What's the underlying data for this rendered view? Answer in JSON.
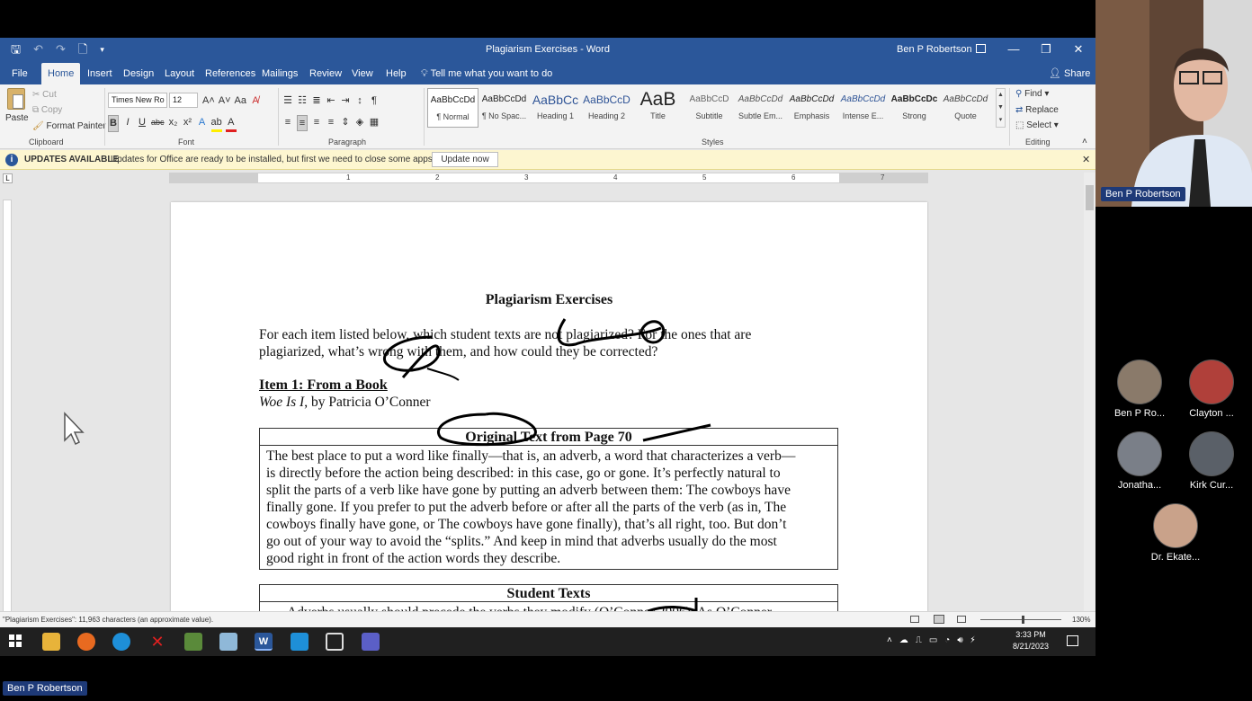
{
  "window": {
    "title": "Plagiarism Exercises  -  Word",
    "user": "Ben P Robertson",
    "minimize": "—",
    "maximize": "❐",
    "close": "✕"
  },
  "quick_access": {
    "save": "🖫",
    "undo": "↶",
    "redo": "↷",
    "new": "🗋",
    "more": "▾"
  },
  "tabs": [
    "File",
    "Home",
    "Insert",
    "Design",
    "Layout",
    "References",
    "Mailings",
    "Review",
    "View",
    "Help"
  ],
  "active_tab": "Home",
  "tell_me": "Tell me what you want to do",
  "share": "Share",
  "clipboard": {
    "paste": "Paste",
    "cut": "Cut",
    "copy": "Copy",
    "format_painter": "Format Painter",
    "label": "Clipboard"
  },
  "font": {
    "name": "Times New Ro",
    "size": "12",
    "label": "Font",
    "bold": "B",
    "italic": "I",
    "underline": "U",
    "strike": "abc",
    "sub": "x₂",
    "sup": "x²",
    "grow": "A˄",
    "shrink": "A˅",
    "case": "Aa",
    "text_effects": "A",
    "highlight": "ab",
    "color": "A"
  },
  "paragraph": {
    "label": "Paragraph"
  },
  "styles": {
    "label": "Styles",
    "items": [
      {
        "preview": "AaBbCcDd",
        "name": "¶ Normal"
      },
      {
        "preview": "AaBbCcDd",
        "name": "¶ No Spac..."
      },
      {
        "preview": "AaBbCc",
        "name": "Heading 1"
      },
      {
        "preview": "AaBbCcD",
        "name": "Heading 2"
      },
      {
        "preview": "AaB",
        "name": "Title"
      },
      {
        "preview": "AaBbCcD",
        "name": "Subtitle"
      },
      {
        "preview": "AaBbCcDd",
        "name": "Subtle Em..."
      },
      {
        "preview": "AaBbCcDd",
        "name": "Emphasis"
      },
      {
        "preview": "AaBbCcDd",
        "name": "Intense E..."
      },
      {
        "preview": "AaBbCcDc",
        "name": "Strong"
      },
      {
        "preview": "AaBbCcDd",
        "name": "Quote"
      }
    ]
  },
  "editing": {
    "find": "Find",
    "replace": "Replace",
    "select": "Select",
    "label": "Editing"
  },
  "update_bar": {
    "icon": "i",
    "title": "UPDATES AVAILABLE",
    "message": "Updates for Office are ready to be installed, but first we need to close some apps.",
    "button": "Update now",
    "close": "✕"
  },
  "ruler_numbers": [
    "1",
    "2",
    "3",
    "4",
    "5",
    "6",
    "7"
  ],
  "document": {
    "title": "Plagiarism Exercises",
    "intro_line1": "For each item listed below, which student texts are not plagiarized? For the ones that are",
    "intro_line2": "plagiarized, what’s wrong with them, and how could they be corrected?",
    "item_title": "Item 1:  From a Book",
    "source_book": "Woe Is I",
    "source_rest": ", by Patricia O’Conner",
    "original_header": "Original Text from Page 70",
    "original_lines": [
      "The best place to put a word like finally—that is, an adverb, a word that characterizes a verb—",
      "is directly before the action being described: in this case, go or gone.  It’s perfectly natural to",
      "split the parts of a verb like have gone by putting an adverb between them:  The cowboys have",
      "finally gone.  If you prefer to put the adverb before or after all the parts of the verb (as in, The",
      "cowboys finally have gone, or The cowboys have gone finally), that’s all right, too.  But don’t",
      "go out of your way to avoid the “splits.”  And keep in mind that adverbs usually do the most",
      "good right in front of the action words they describe."
    ],
    "student_header": "Student Texts",
    "student_partial": "Adverbs usually should precede the verbs they modify (O’Conner 2006).  As O’Conner"
  },
  "status_bar": {
    "text": "\"Plagiarism Exercises\": 11,963 characters (an approximate value).",
    "zoom": "130%"
  },
  "taskbar": {
    "time": "3:33 PM",
    "date": "8/21/2023"
  },
  "meeting": {
    "presenter_name": "Ben P Robertson",
    "self_name": "Ben P Robertson",
    "participants": [
      {
        "name": "Ben P Ro...",
        "color": "#8a7a6a"
      },
      {
        "name": "Clayton ...",
        "color": "#b0403a"
      },
      {
        "name": "Jonatha...",
        "color": "#7a7f88"
      },
      {
        "name": "Kirk Cur...",
        "color": "#5a6068"
      },
      {
        "name": "Dr. Ekate...",
        "color": "#c9a28a"
      }
    ]
  },
  "colors": {
    "word_blue": "#2b579a",
    "ink": "#000000",
    "update_bar": "#fdf6d0"
  }
}
